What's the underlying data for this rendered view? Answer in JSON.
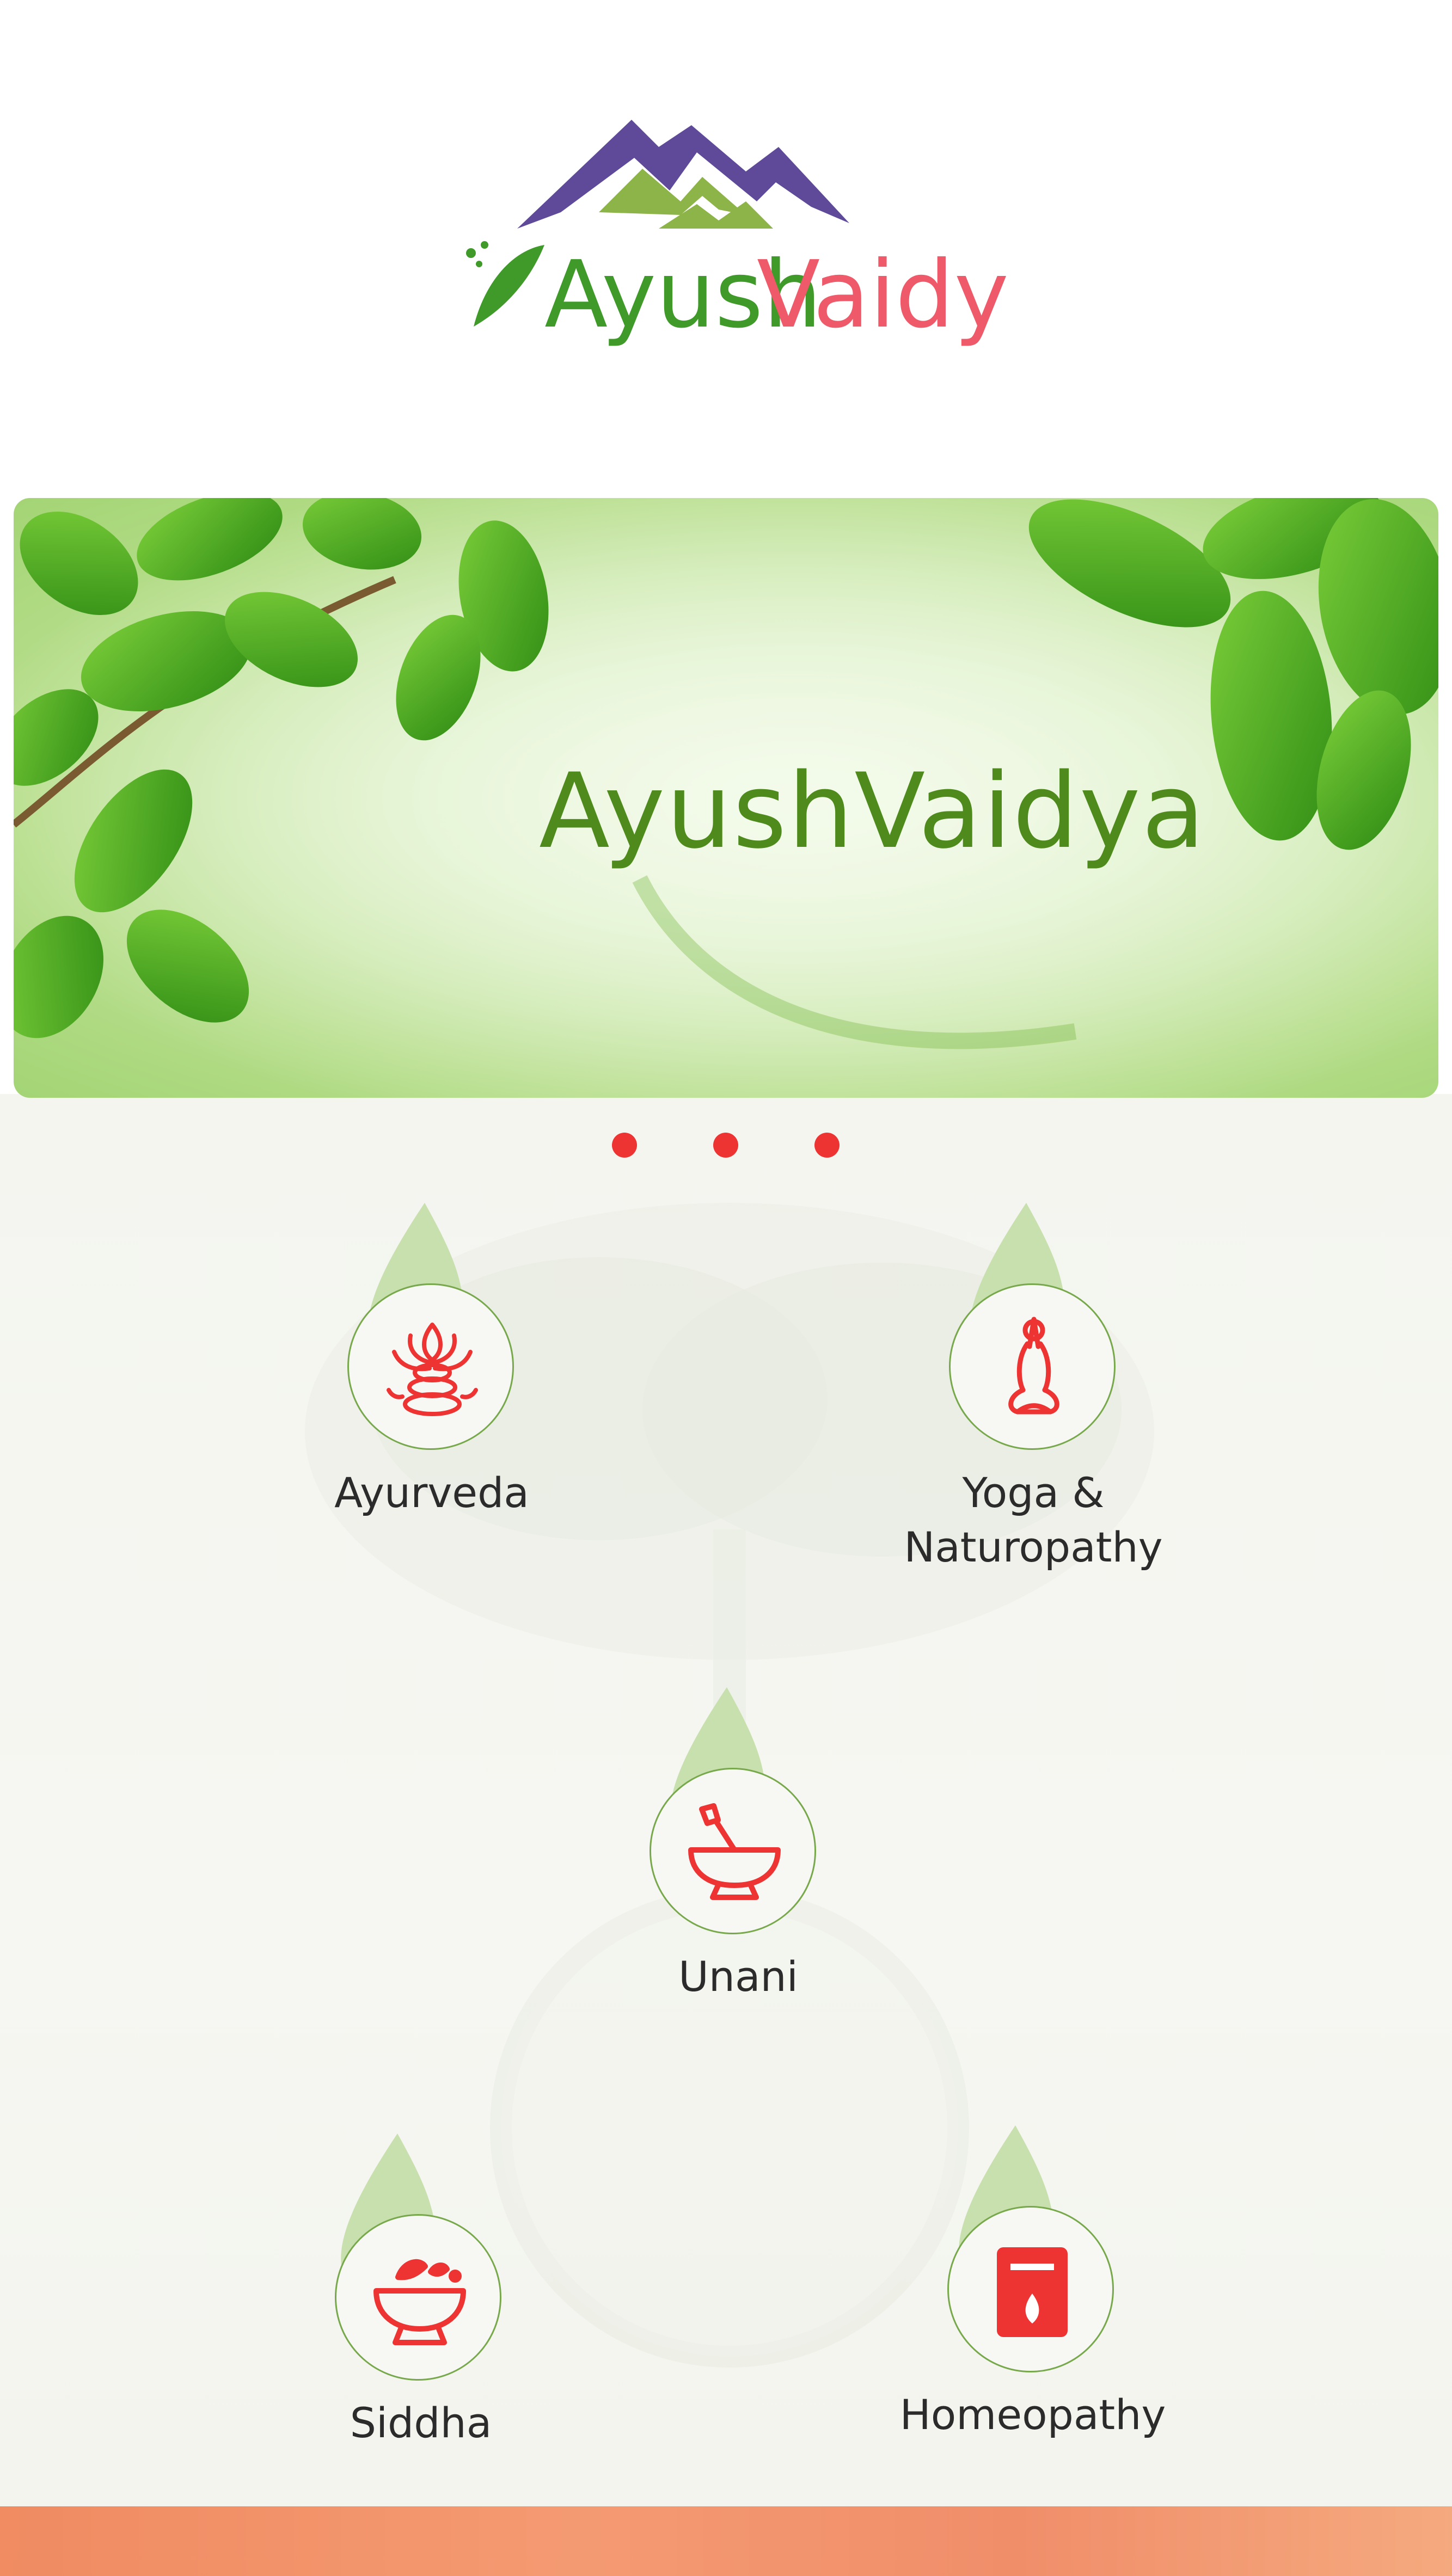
{
  "app": {
    "logo_text_part1": "Ayush",
    "logo_text_part2": "Vaidya"
  },
  "banner": {
    "title": "AyushVaidya",
    "slide_count": 3,
    "active_slide": 1
  },
  "categories": [
    {
      "label": "Ayurveda",
      "icon": "lotus-stones-icon"
    },
    {
      "label": "Yoga &\nNaturopathy",
      "icon": "yoga-pose-icon"
    },
    {
      "label": "Unani",
      "icon": "mortar-pestle-icon"
    },
    {
      "label": "Siddha",
      "icon": "herbal-bowl-icon"
    },
    {
      "label": "Homeopathy",
      "icon": "remedy-bottle-icon"
    }
  ],
  "colors": {
    "accent_red": "#ee3333",
    "brand_green": "#4e8a1c",
    "ring_green": "#78a84c",
    "logo_purple": "#5e4a98",
    "logo_pink": "#ee5a6a",
    "footer_orange": "#f08b62"
  }
}
